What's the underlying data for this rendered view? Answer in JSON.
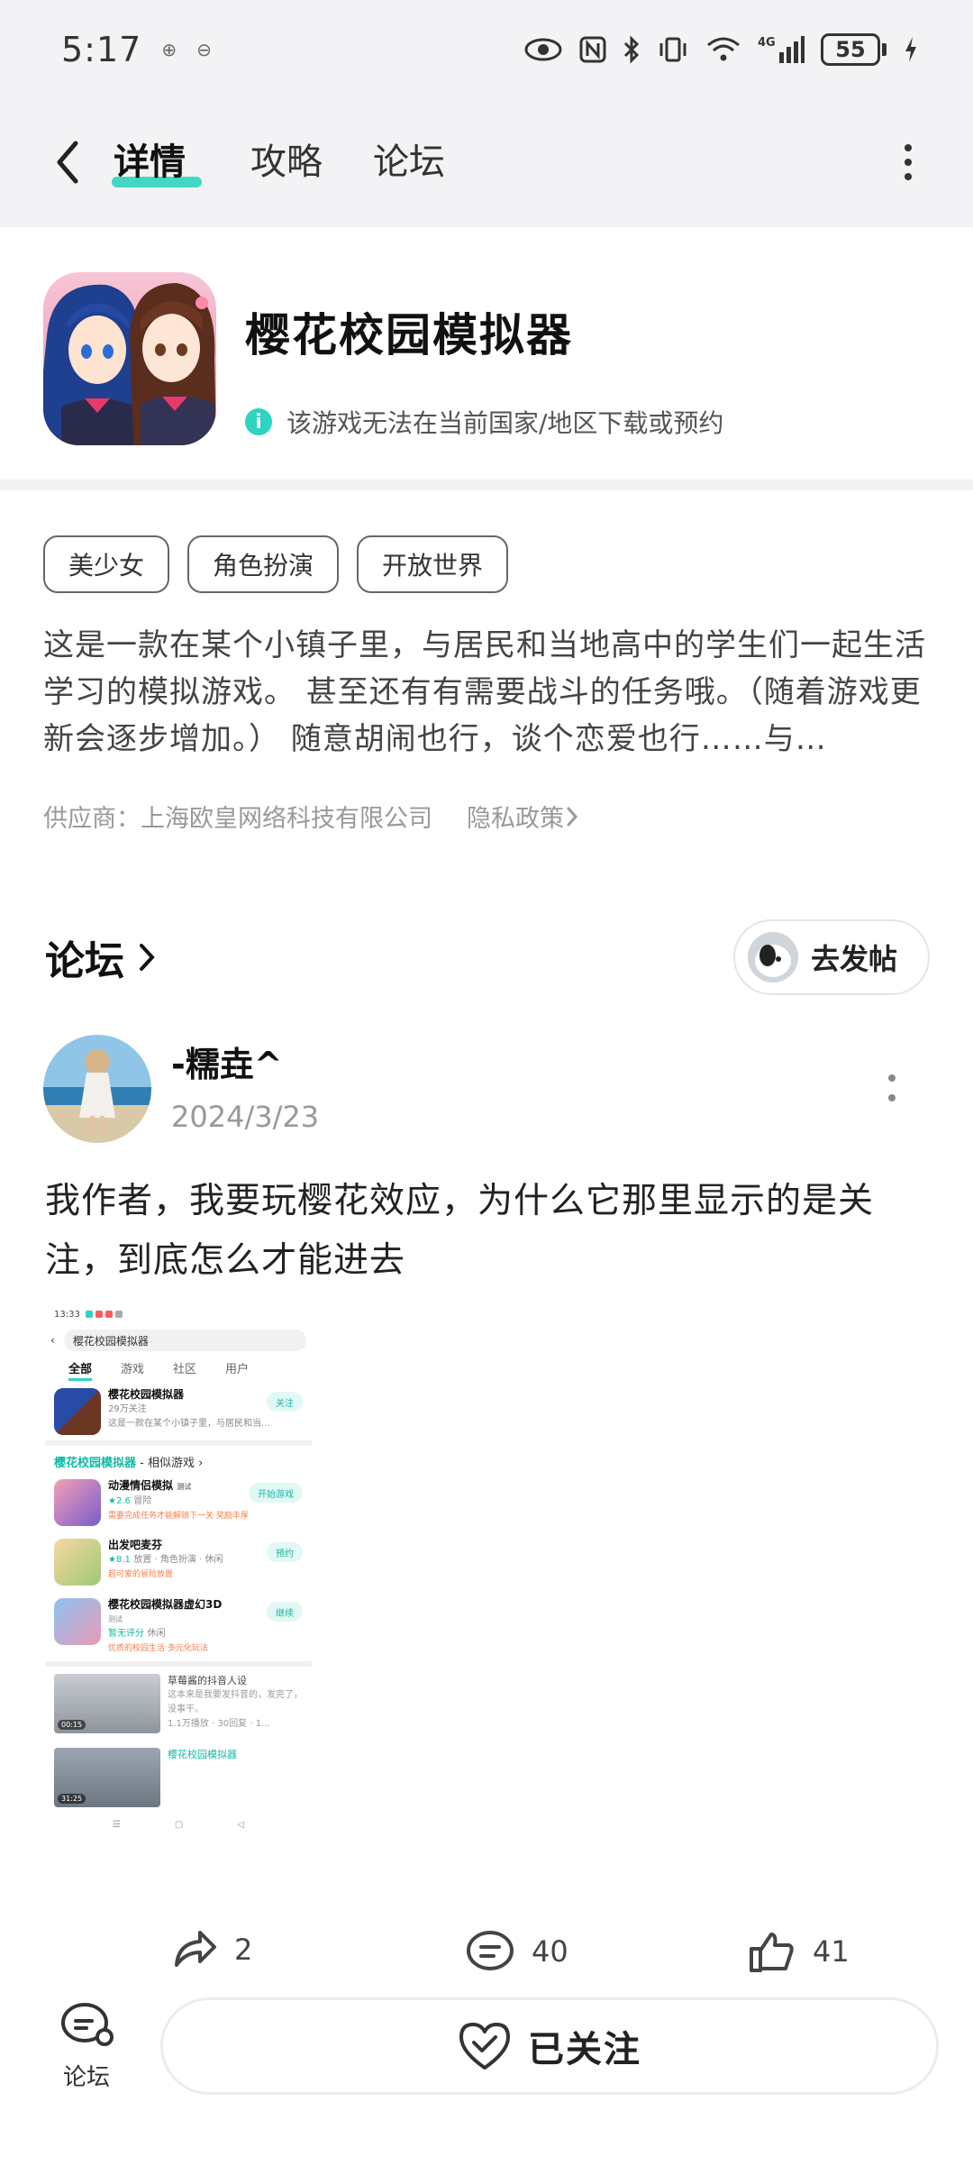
{
  "status_bar": {
    "time": "5:17",
    "network": "4G",
    "battery": "55"
  },
  "nav": {
    "tabs": [
      {
        "label": "详情",
        "active": true
      },
      {
        "label": "攻略",
        "active": false
      },
      {
        "label": "论坛",
        "active": false
      }
    ]
  },
  "app": {
    "title": "樱花校园模拟器",
    "notice": "该游戏无法在当前国家/地区下载或预约",
    "tags": [
      "美少女",
      "角色扮演",
      "开放世界"
    ],
    "description": "这是一款在某个小镇子里，与居民和当地高中的学生们一起生活学习的模拟游戏。 甚至还有有需要战斗的任务哦。（随着游戏更新会逐步增加。） 随意胡闹也行，谈个恋爱也行……与…",
    "supplier": "供应商：上海欧皇网络科技有限公司",
    "privacy_label": "隐私政策"
  },
  "forum": {
    "title": "论坛",
    "post_button": "去发帖",
    "post": {
      "username": "-糯垚^",
      "date": "2024/3/23",
      "text": "我作者，我要玩樱花效应，为什么它那里显示的是关注，到底怎么才能进去",
      "screenshot": {
        "status_time": "13:33",
        "search_text": "樱花校园模拟器",
        "tabs": [
          "全部",
          "游戏",
          "社区",
          "用户"
        ],
        "main_game": {
          "name": "樱花校园模拟器",
          "sub": "29万关注",
          "desc": "这是一款在某个小镇子里，与居民和当…",
          "button": "关注"
        },
        "similar_header": "樱花校园模拟器",
        "similar_suffix": " - 相似游戏 ›",
        "similar": [
          {
            "name": "动漫情侣模拟",
            "badge": "测试",
            "rating": "★2.6",
            "genre": "冒险",
            "hint": "需要完成任务才能解锁下一关 奖励丰厚",
            "button": "开始游戏"
          },
          {
            "name": "出发吧麦芬",
            "badge": "",
            "rating": "★8.1",
            "genre": "放置 · 角色扮演 · 休闲",
            "hint": "超可爱的冒险放置",
            "button": "预约"
          },
          {
            "name": "樱花校园模拟器虚幻3D",
            "badge": "测试",
            "rating": "暂无评分",
            "genre": "休闲",
            "hint": "优质的校园生活 多元化玩法",
            "button": "继续"
          }
        ],
        "videos": [
          {
            "title": "草莓酱的抖音人设",
            "desc": "这本来是我要发抖音的，发完了，没事干。",
            "meta": "1.1万播放 · 30回复 · 1…",
            "duration": "00:15"
          },
          {
            "title": "樱花校园模拟器",
            "desc": "",
            "meta": "",
            "duration": "31:25"
          }
        ],
        "nav_keys": [
          "☰",
          "▢",
          "◁"
        ]
      }
    },
    "counts": {
      "share": "2",
      "comment": "40",
      "like": "41"
    }
  },
  "bottom_bar": {
    "forum_label": "论坛",
    "follow_label": "已关注"
  },
  "colors": {
    "accent": "#2dd4bf",
    "background_gray": "#f3f3f5"
  }
}
